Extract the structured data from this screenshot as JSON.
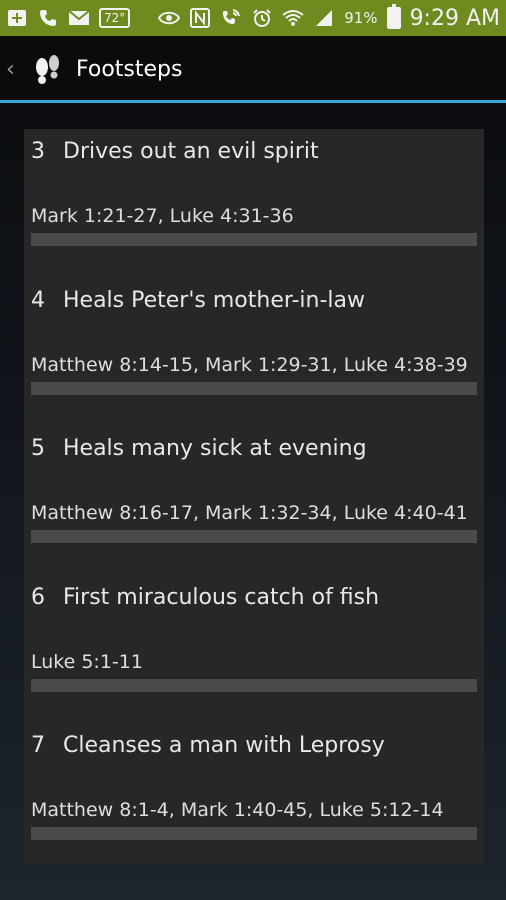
{
  "status_bar": {
    "temperature": "72°",
    "battery_percent": "91%",
    "time": "9:29 AM",
    "left_icons": [
      "add-contact-icon",
      "phone-icon",
      "mail-icon",
      "weather-temp-icon"
    ],
    "right_icons": [
      "eye-icon",
      "nfc-icon",
      "wifi-calling-icon",
      "alarm-icon",
      "wifi-icon",
      "signal-icon",
      "battery-icon"
    ]
  },
  "action_bar": {
    "title": "Footsteps"
  },
  "items": [
    {
      "number": "3",
      "title": "Drives out an evil spirit",
      "refs": "Mark 1:21-27, Luke 4:31-36"
    },
    {
      "number": "4",
      "title": "Heals Peter's mother-in-law",
      "refs": "Matthew 8:14-15, Mark 1:29-31, Luke 4:38-39"
    },
    {
      "number": "5",
      "title": "Heals many sick at evening",
      "refs": "Matthew 8:16-17, Mark 1:32-34, Luke 4:40-41"
    },
    {
      "number": "6",
      "title": "First miraculous catch of fish",
      "refs": "Luke 5:1-11"
    },
    {
      "number": "7",
      "title": "Cleanses a man with Leprosy",
      "refs": "Matthew 8:1-4, Mark 1:40-45, Luke 5:12-14"
    }
  ],
  "colors": {
    "status_bar": "#6f8a1f",
    "accent": "#3aa8d6",
    "card": "#272727",
    "divider_bar": "#4b4b4b"
  }
}
